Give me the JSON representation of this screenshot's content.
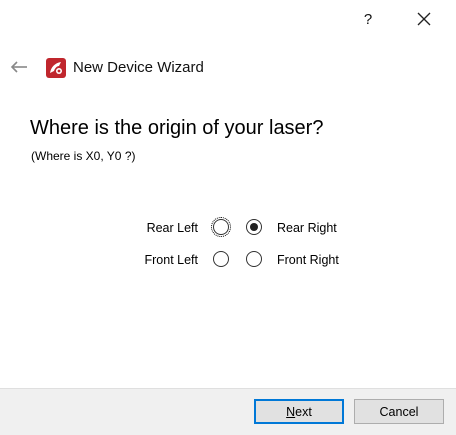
{
  "titlebar": {
    "help_label": "?",
    "close_icon": "close-icon"
  },
  "header": {
    "back_icon": "back-arrow-icon",
    "app_icon": "app-logo-icon",
    "title": "New Device Wizard"
  },
  "main": {
    "question": "Where is the origin of your laser?",
    "subquestion": "(Where is X0, Y0 ?)",
    "options": [
      {
        "label": "Rear Left",
        "selected": false,
        "focused": true
      },
      {
        "label": "Rear Right",
        "selected": true,
        "focused": false
      },
      {
        "label": "Front Left",
        "selected": false,
        "focused": false
      },
      {
        "label": "Front Right",
        "selected": false,
        "focused": false
      }
    ]
  },
  "footer": {
    "next_label_underlined": "N",
    "next_label_rest": "ext",
    "cancel_label": "Cancel"
  },
  "colors": {
    "footer_bg": "#f0f0f0",
    "accent": "#0078d7",
    "app_icon_red": "#c0262d"
  }
}
